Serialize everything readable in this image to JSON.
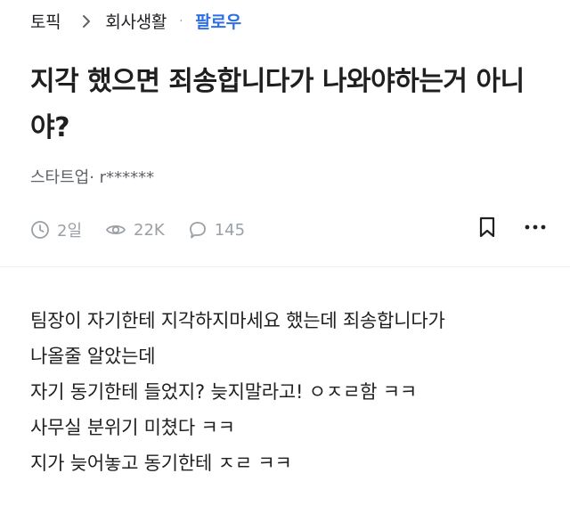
{
  "breadcrumb": {
    "topic": "토픽",
    "board": "회사생활",
    "separator": "·",
    "follow_label": "팔로우"
  },
  "post": {
    "title": "지각 했으면 죄송합니다가 나와야하는거 아니야?",
    "author": "스타트업· r******",
    "stats": {
      "time": "2일",
      "views": "22K",
      "comments": "145"
    },
    "body_lines": [
      "팀장이 자기한테 지각하지마세요 했는데 죄송합니다가",
      "나올줄 알았는데",
      "자기 동기한테 들었지? 늦지말라고! ㅇㅈㄹ함 ㅋㅋ",
      "사무실 분위기 미쳤다 ㅋㅋ",
      "지가 늦어놓고 동기한테 ㅈㄹ ㅋㅋ"
    ]
  },
  "icons": {
    "chevron": "chevron-right-icon",
    "clock": "clock-icon",
    "eye": "eye-icon",
    "comment": "comment-icon",
    "bookmark": "bookmark-icon",
    "more": "more-vertical-icon"
  },
  "colors": {
    "accent": "#2f6fe4",
    "muted": "#9aa0a6"
  }
}
